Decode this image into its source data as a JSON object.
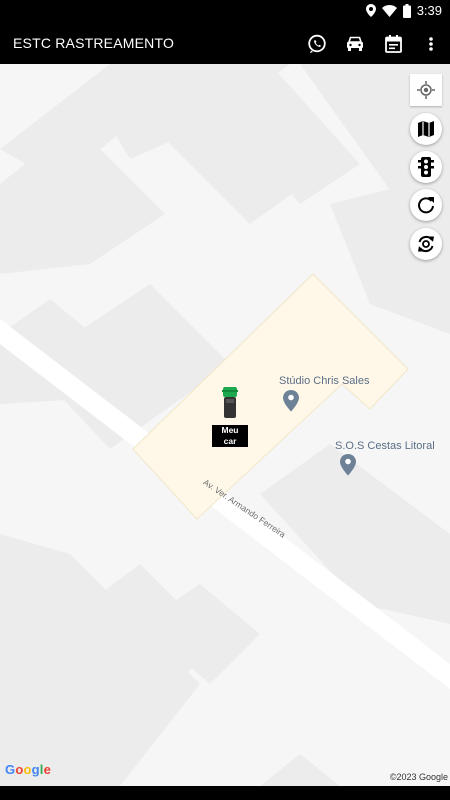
{
  "status_bar": {
    "time": "3:39"
  },
  "app_bar": {
    "title": "ESTC RASTREAMENTO",
    "actions": [
      "whatsapp-icon",
      "car-icon",
      "calendar-icon",
      "more-vert-icon"
    ]
  },
  "map": {
    "controls": [
      "my-location-icon",
      "map-icon",
      "traffic-light-icon",
      "refresh-icon",
      "sync-icon"
    ],
    "places": [
      {
        "name": "Stúdio Chris Sales"
      },
      {
        "name": "S.O.S Cestas Litoral"
      }
    ],
    "street": "Av. Ver. Armando Ferreira",
    "marker_label": "Meu car",
    "google_logo": "Google",
    "copyright": "©2023 Google",
    "colors": {
      "background": "#f6f6f6",
      "block": "#ececec",
      "lot": "#fff8e8",
      "road": "#ffffff",
      "pin": "#6e8297",
      "marker": "#1ca84f"
    }
  }
}
